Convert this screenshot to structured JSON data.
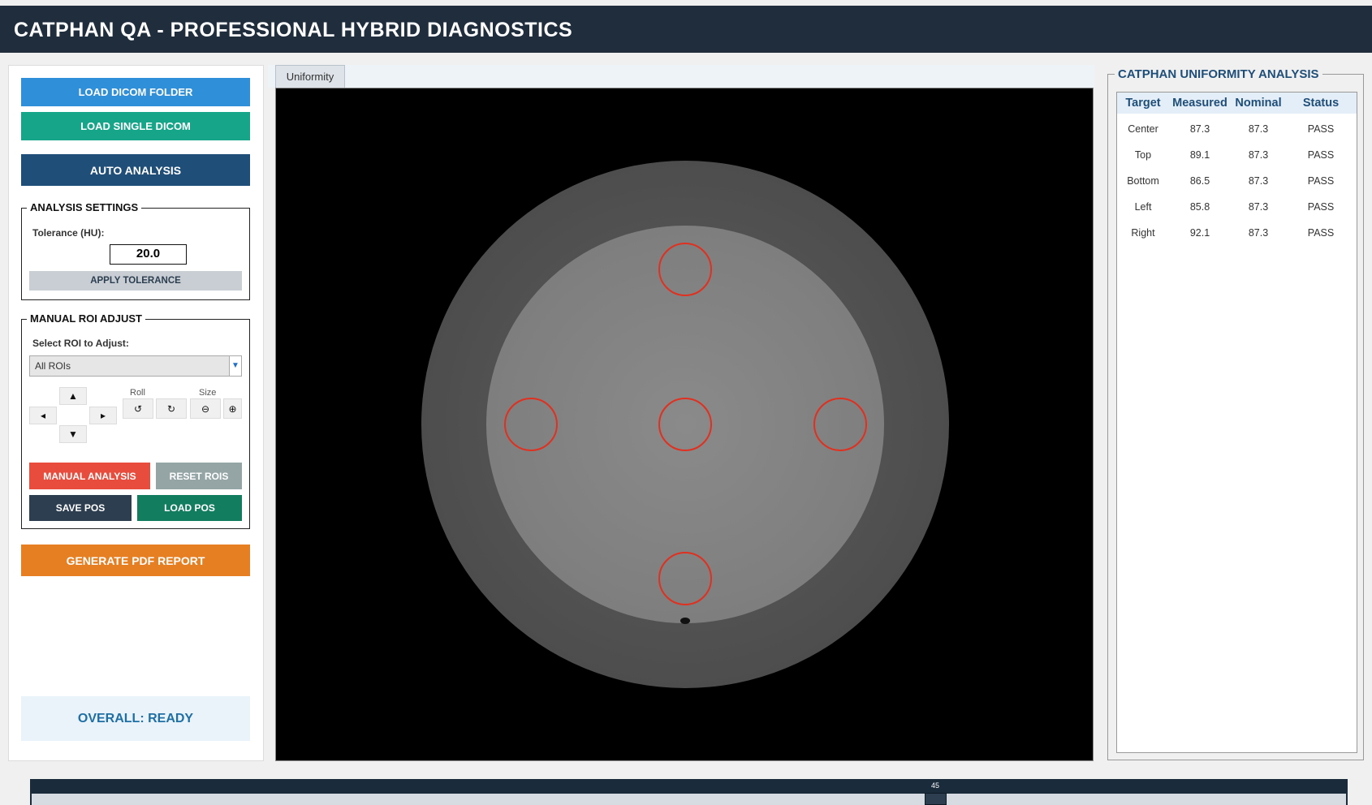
{
  "app": {
    "title": "CATPHAN QA - PROFESSIONAL HYBRID DIAGNOSTICS"
  },
  "left": {
    "load_folder": "LOAD DICOM FOLDER",
    "load_single": "LOAD SINGLE DICOM",
    "auto_analysis": "AUTO ANALYSIS",
    "settings": {
      "legend": "ANALYSIS SETTINGS",
      "tolerance_label": "Tolerance (HU):",
      "tolerance_value": "20.0",
      "apply": "APPLY TOLERANCE"
    },
    "roi": {
      "legend": "MANUAL ROI ADJUST",
      "select_label": "Select ROI to Adjust:",
      "select_value": "All ROIs",
      "roll_label": "Roll",
      "size_label": "Size",
      "manual_analysis": "MANUAL ANALYSIS",
      "reset_rois": "RESET ROIS",
      "save_pos": "SAVE POS",
      "load_pos": "LOAD POS"
    },
    "generate_pdf": "GENERATE PDF REPORT",
    "overall_status": "OVERALL: READY"
  },
  "viewer": {
    "tab_label": "Uniformity"
  },
  "results": {
    "legend": "CATPHAN UNIFORMITY ANALYSIS",
    "columns": [
      "Target",
      "Measured",
      "Nominal",
      "Status"
    ],
    "rows": [
      [
        "Center",
        "87.3",
        "87.3",
        "PASS"
      ],
      [
        "Top",
        "89.1",
        "87.3",
        "PASS"
      ],
      [
        "Bottom",
        "86.5",
        "87.3",
        "PASS"
      ],
      [
        "Left",
        "85.8",
        "87.3",
        "PASS"
      ],
      [
        "Right",
        "92.1",
        "87.3",
        "PASS"
      ]
    ]
  },
  "slice_slider": {
    "value": "45"
  },
  "colors": {
    "title_bar": "#1f2d3d",
    "accent_blue": "#2f8fd8",
    "teal": "#17a589",
    "roi_circle": "#e03020",
    "orange": "#e67e22",
    "red": "#e74c3c"
  },
  "icons": [
    "up-arrow-icon",
    "down-arrow-icon",
    "left-arrow-icon",
    "right-arrow-icon",
    "rotate-ccw-icon",
    "rotate-cw-icon",
    "shrink-icon",
    "grow-icon",
    "dropdown-arrow-icon"
  ]
}
